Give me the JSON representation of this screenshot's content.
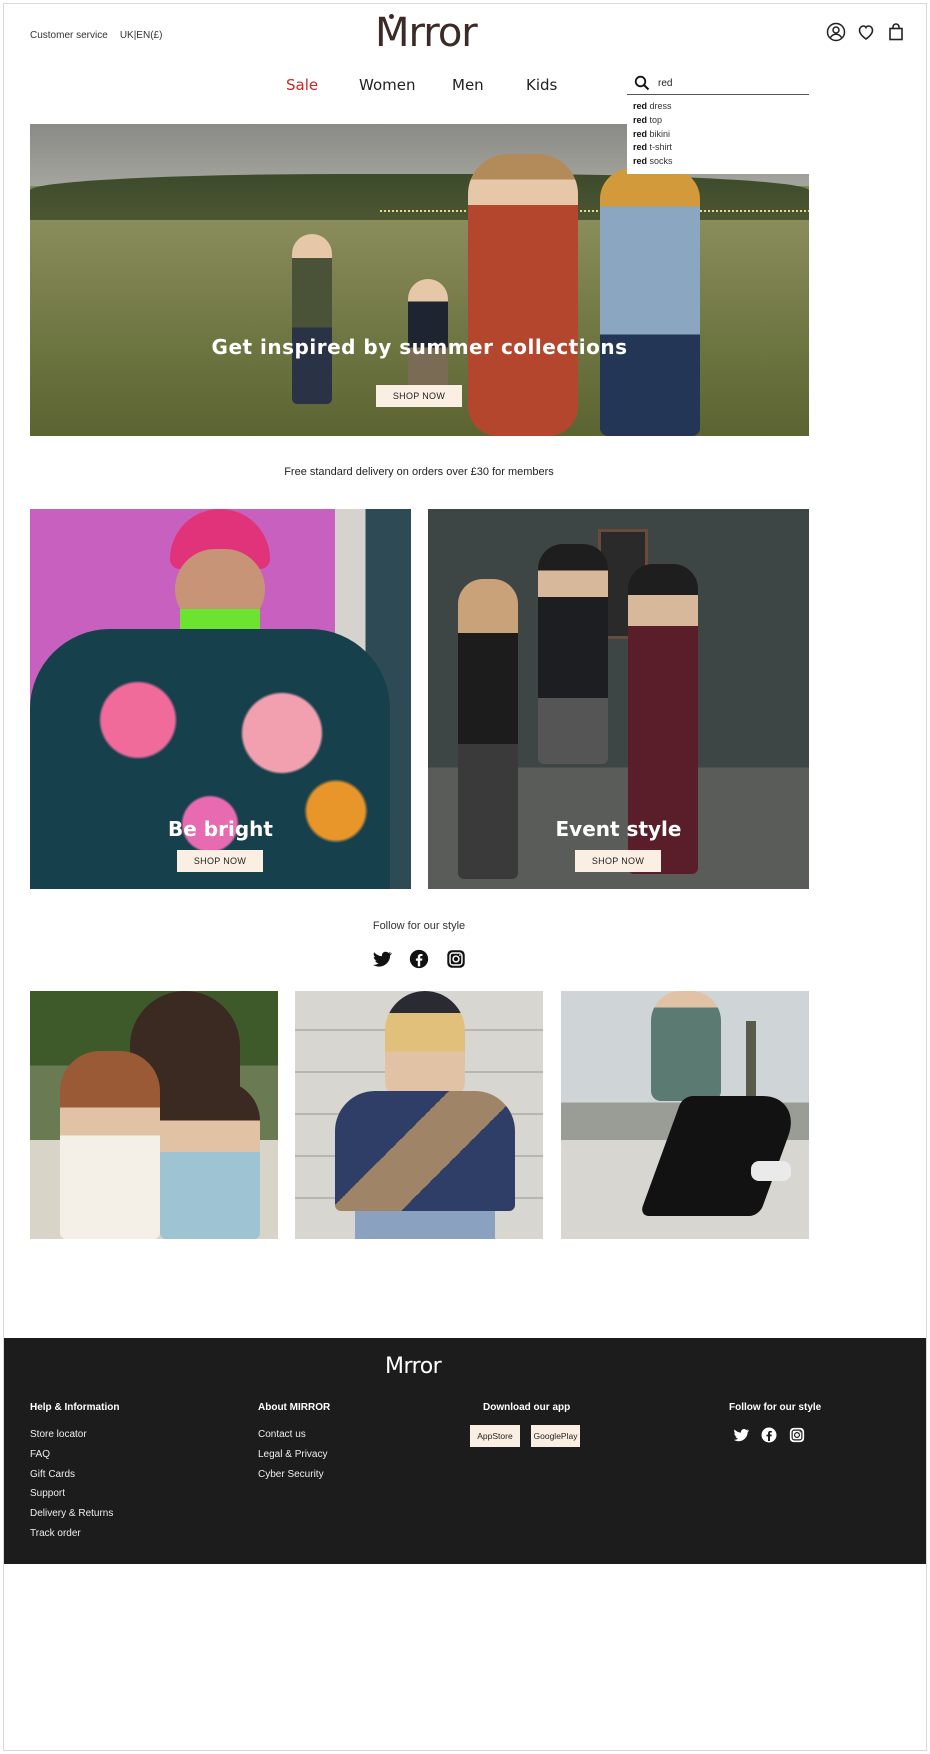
{
  "header": {
    "customer_service": "Customer service",
    "locale": "UK|EN(£)",
    "logo": "Mrror",
    "icons": [
      "account-icon",
      "heart-icon",
      "shopping-bag-icon"
    ]
  },
  "nav": {
    "items": [
      "Sale",
      "Women",
      "Men",
      "Kids"
    ],
    "sale_color": "#c62828"
  },
  "search": {
    "value": "red",
    "suggestions": [
      {
        "bold": "red",
        "rest": " dress"
      },
      {
        "bold": "red",
        "rest": " top"
      },
      {
        "bold": "red",
        "rest": " bikini"
      },
      {
        "bold": "red",
        "rest": " t-shirt"
      },
      {
        "bold": "red",
        "rest": " socks"
      }
    ]
  },
  "hero": {
    "title": "Get inspired by summer collections",
    "button": "SHOP NOW"
  },
  "delivery_note": "Free standard delivery on orders over £30 for members",
  "promos": [
    {
      "title": "Be bright",
      "button": "SHOP NOW"
    },
    {
      "title": "Event style",
      "button": "SHOP NOW"
    }
  ],
  "follow": {
    "title": "Follow for our style",
    "icons": [
      "twitter-icon",
      "facebook-icon",
      "instagram-icon"
    ]
  },
  "footer": {
    "logo": "Mrror",
    "help": {
      "title": "Help & Information",
      "links": [
        "Store locator",
        "FAQ",
        "Gift Cards",
        "Support",
        "Delivery & Returns",
        "Track order"
      ]
    },
    "about": {
      "title": "About MIRROR",
      "links": [
        "Contact us",
        "Legal & Privacy",
        "Cyber Security"
      ]
    },
    "app": {
      "title": "Download our app",
      "buttons": [
        "AppStore",
        "GooglePlay"
      ]
    },
    "social": {
      "title": "Follow for our style"
    }
  },
  "colors": {
    "brand": "#3b2a26",
    "button_bg": "#fbefe4",
    "footer_bg": "#1c1c1c"
  }
}
